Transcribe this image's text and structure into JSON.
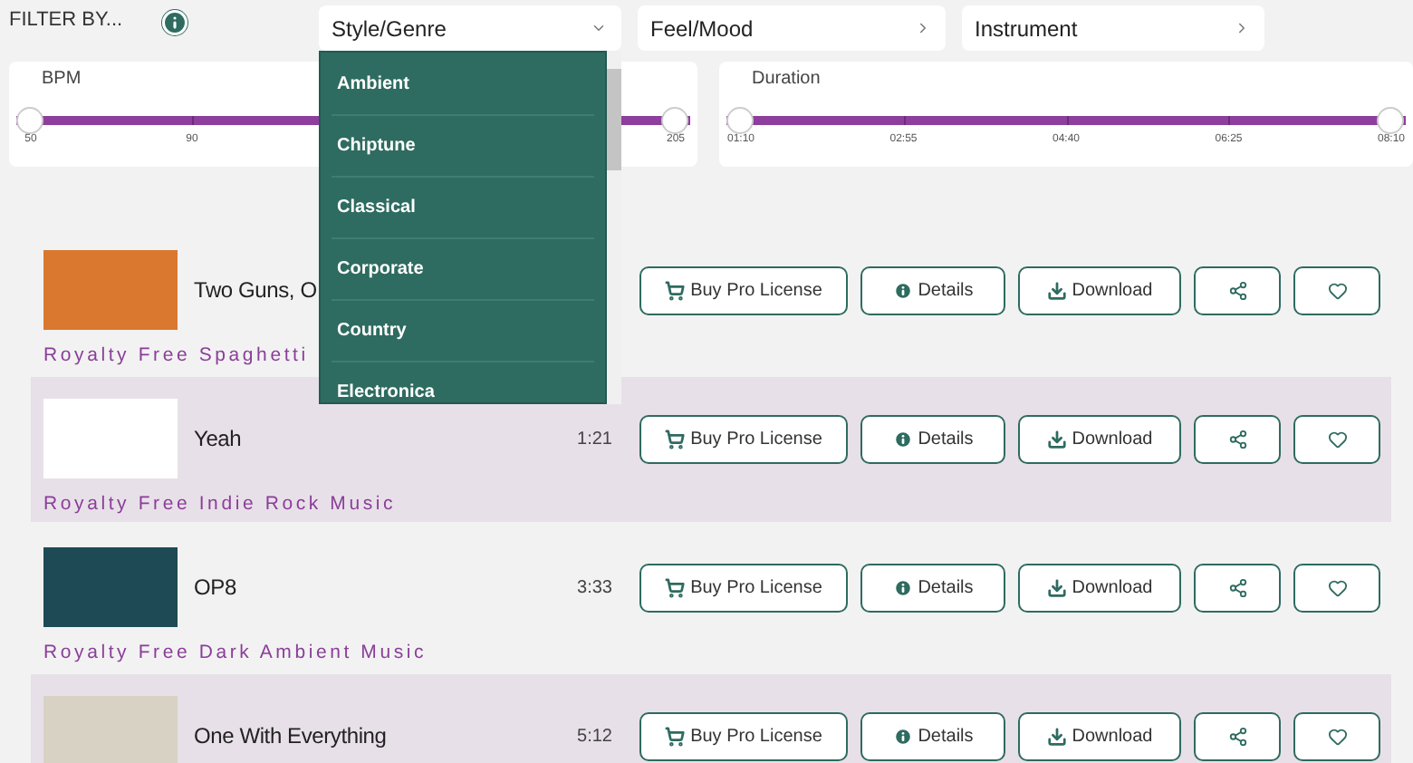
{
  "filter_label": "FILTER BY...",
  "filters": [
    {
      "label": "Style/Genre",
      "expanded": true
    },
    {
      "label": "Feel/Mood",
      "expanded": false
    },
    {
      "label": "Instrument",
      "expanded": false
    }
  ],
  "sliders": [
    {
      "label": "BPM",
      "handles": [
        {
          "level": 0
        },
        {
          "level": 1
        }
      ],
      "ticks": [
        "50",
        "90",
        "205"
      ]
    },
    {
      "label": "Duration",
      "handles": [
        {
          "level": 0
        },
        {
          "level": 1
        }
      ],
      "ticks": [
        "01:10",
        "02:55",
        "04:40",
        "06:25",
        "08:10"
      ]
    }
  ],
  "genre_menu": [
    "Ambient",
    "Chiptune",
    "Classical",
    "Corporate",
    "Country",
    "Electronica"
  ],
  "tracks": [
    {
      "title": "Two Guns, O",
      "subtitle": "Royalty Free Spaghetti",
      "color": "#d9782e",
      "highlighted": false,
      "buy": "Buy Pro License",
      "details": "Details",
      "download": "Download"
    },
    {
      "title": "Yeah",
      "duration": "1:21",
      "subtitle": "Royalty Free Indie Rock Music",
      "color": "#ffffff",
      "highlighted": true,
      "buy": "Buy Pro License",
      "details": "Details",
      "download": "Download"
    },
    {
      "title": "OP8",
      "duration": "3:33",
      "subtitle": "Royalty Free Dark Ambient Music",
      "color": "#1d4a54",
      "highlighted": false,
      "buy": "Buy Pro License",
      "details": "Details",
      "download": "Download"
    },
    {
      "title": "One With Everything",
      "duration": "5:12",
      "color": "#d8d2c4",
      "highlighted": true,
      "buy": "Buy Pro License",
      "details": "Details",
      "download": "Download"
    }
  ]
}
